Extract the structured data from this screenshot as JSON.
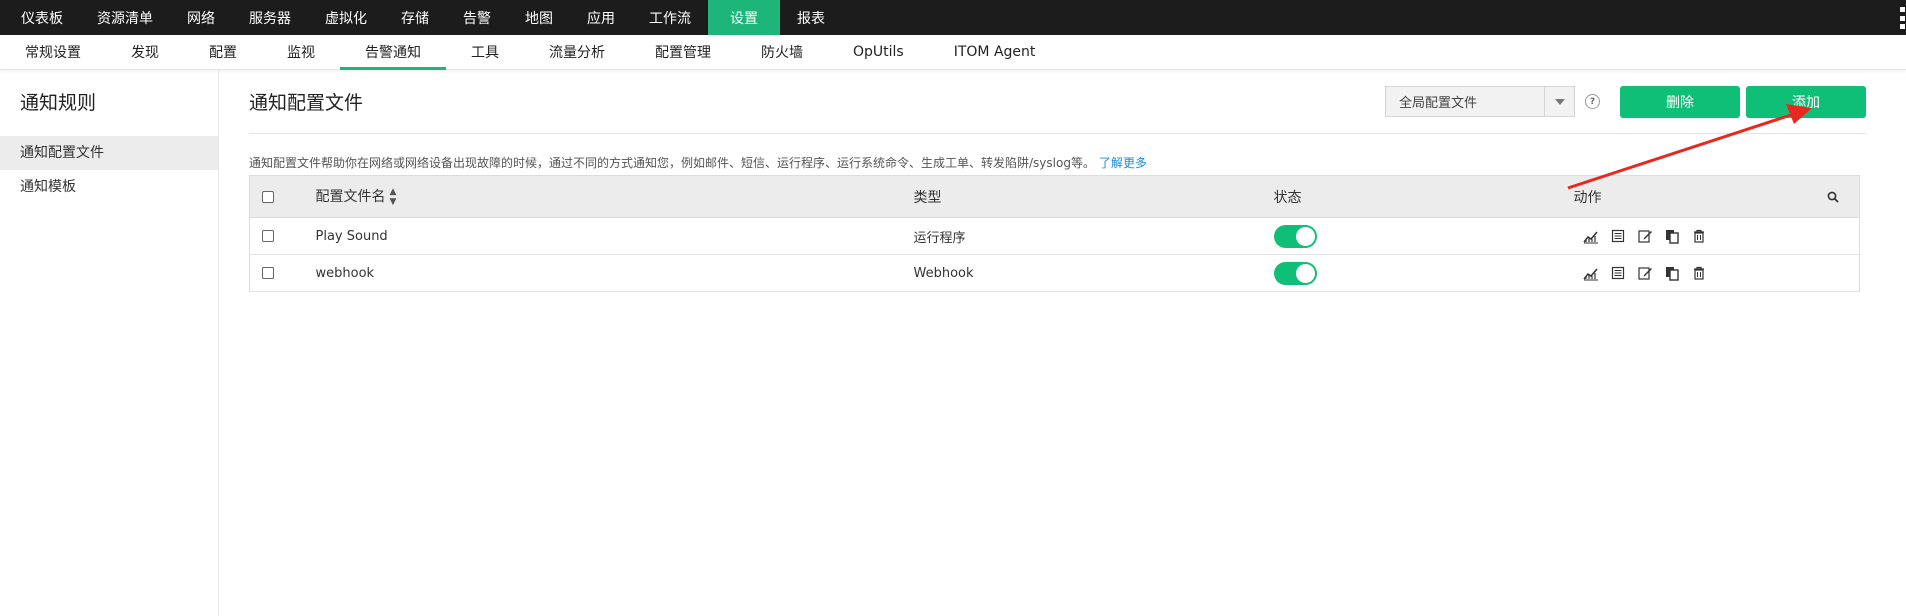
{
  "topnav": {
    "items": [
      "仪表板",
      "资源清单",
      "网络",
      "服务器",
      "虚拟化",
      "存储",
      "告警",
      "地图",
      "应用",
      "工作流",
      "设置",
      "报表"
    ],
    "active_index": 10
  },
  "subnav": {
    "items": [
      "常规设置",
      "发现",
      "配置",
      "监视",
      "告警通知",
      "工具",
      "流量分析",
      "配置管理",
      "防火墙",
      "OpUtils",
      "ITOM Agent"
    ],
    "active_index": 4
  },
  "sidebar": {
    "title": "通知规则",
    "items": [
      {
        "label": "通知配置文件",
        "active": true
      },
      {
        "label": "通知模板",
        "active": false
      }
    ]
  },
  "main": {
    "title": "通知配置文件",
    "filter_value": "全局配置文件",
    "help_label": "?",
    "delete_label": "删除",
    "add_label": "添加",
    "description": "通知配置文件帮助你在网络或网络设备出现故障的时候，通过不同的方式通知您，例如邮件、短信、运行程序、运行系统命令、生成工单、转发陷阱/syslog等。",
    "learn_more": "了解更多"
  },
  "table": {
    "columns": {
      "name": "配置文件名",
      "type": "类型",
      "status": "状态",
      "actions": "动作"
    },
    "rows": [
      {
        "name": "Play Sound",
        "type": "运行程序",
        "enabled": true
      },
      {
        "name": "webhook",
        "type": "Webhook",
        "enabled": true
      }
    ]
  },
  "colors": {
    "accent": "#1db57a",
    "button": "#10bf77",
    "topnav_bg": "#1c1c1c",
    "link": "#1a8fd8",
    "annotation": "#e8281e"
  }
}
